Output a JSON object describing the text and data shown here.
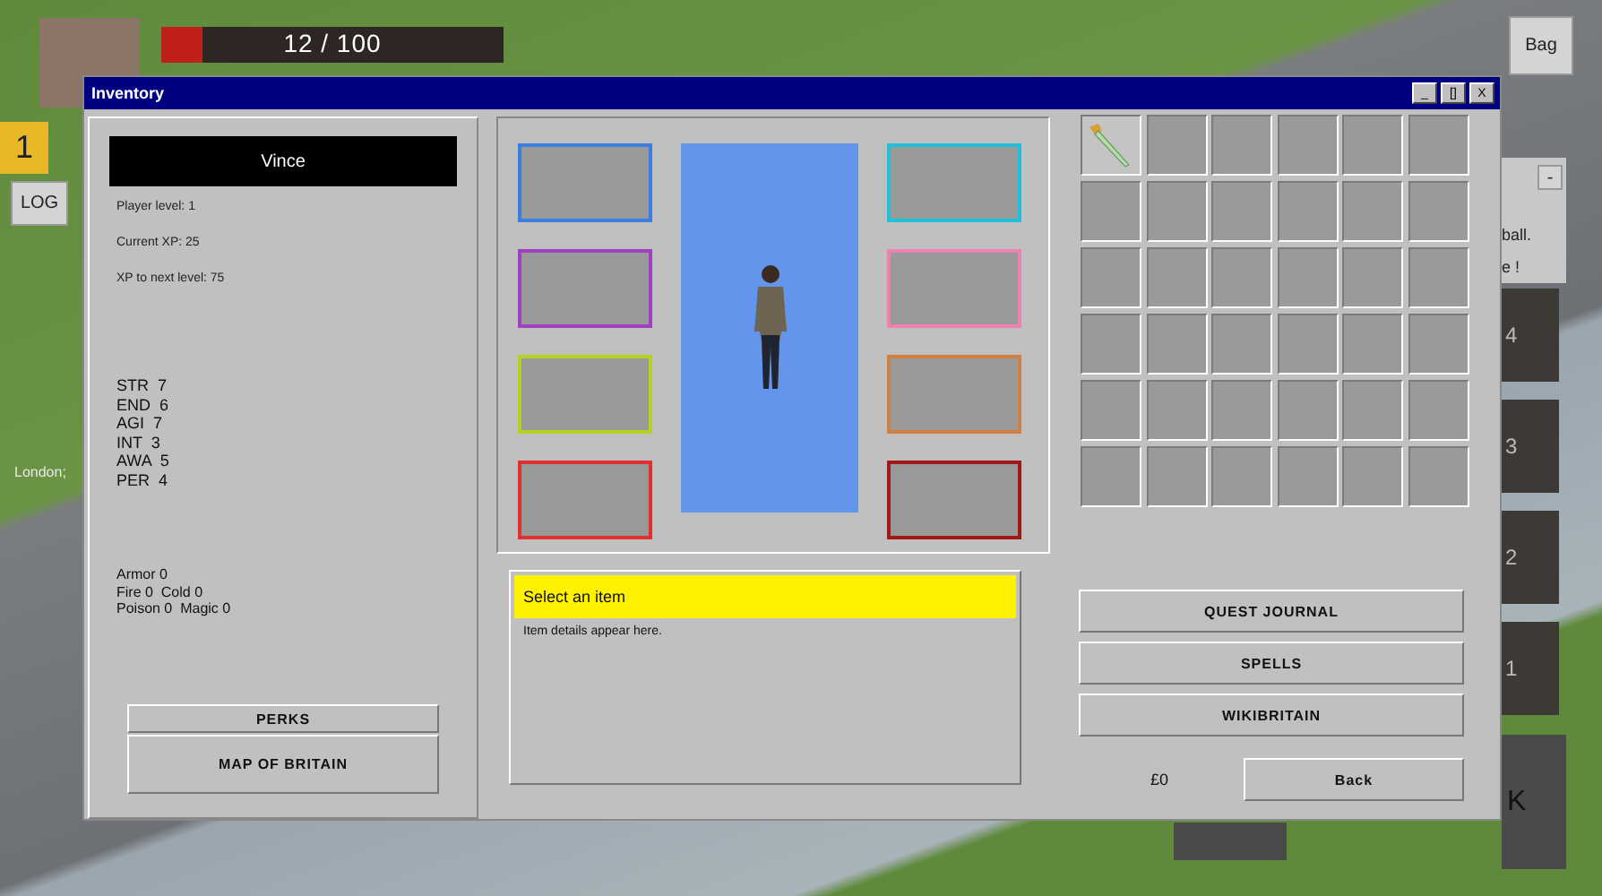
{
  "hud": {
    "health": {
      "reading": "12 / 100",
      "level": 0.12
    },
    "bag_button": "Bag",
    "level_badge": "1",
    "log_button": "LOG",
    "location": "London;",
    "side_panel": {
      "collapse_button": "-",
      "line_1": "ball.",
      "line_2": "e !"
    },
    "hotbar": [
      "4",
      "3",
      "2",
      "1"
    ],
    "key_tile": "K"
  },
  "window": {
    "title": "Inventory",
    "controls": [
      "_",
      "[]",
      "X"
    ]
  },
  "character": {
    "name": "Vince",
    "info": [
      "Player level: 1",
      "Current XP: 25",
      "XP to next level: 75"
    ],
    "attributes": [
      "STR  7",
      "END  6",
      "AGI  7",
      "INT  3",
      "AWA  5",
      "PER  4"
    ],
    "resistances": [
      "Armor 0",
      "Fire 0  Cold 0",
      "Poison 0  Magic 0"
    ],
    "buttons": [
      "PERKS",
      "MAP OF BRITAIN"
    ]
  },
  "equipment": {
    "left_slots": [
      {
        "color": "#3a7ee0"
      },
      {
        "color": "#a040c0"
      },
      {
        "color": "#b8d020"
      },
      {
        "color": "#e03030"
      }
    ],
    "right_slots": [
      {
        "color": "#20c0d8"
      },
      {
        "color": "#f080b0"
      },
      {
        "color": "#d08040"
      },
      {
        "color": "#a01818"
      }
    ]
  },
  "details": {
    "title": "Select an item",
    "text": "Item details appear here."
  },
  "inventory": {
    "cells": [
      {
        "filled": true
      },
      {
        "filled": false
      },
      {
        "filled": false
      },
      {
        "filled": false
      },
      {
        "filled": false
      },
      {
        "filled": false
      },
      {
        "filled": false
      },
      {
        "filled": false
      },
      {
        "filled": false
      },
      {
        "filled": false
      },
      {
        "filled": false
      },
      {
        "filled": false
      },
      {
        "filled": false
      },
      {
        "filled": false
      },
      {
        "filled": false
      },
      {
        "filled": false
      },
      {
        "filled": false
      },
      {
        "filled": false
      },
      {
        "filled": false
      },
      {
        "filled": false
      },
      {
        "filled": false
      },
      {
        "filled": false
      },
      {
        "filled": false
      },
      {
        "filled": false
      },
      {
        "filled": false
      },
      {
        "filled": false
      },
      {
        "filled": false
      },
      {
        "filled": false
      },
      {
        "filled": false
      },
      {
        "filled": false
      },
      {
        "filled": false
      },
      {
        "filled": false
      },
      {
        "filled": false
      },
      {
        "filled": false
      },
      {
        "filled": false
      },
      {
        "filled": false
      }
    ]
  },
  "menu_buttons": [
    "QUEST JOURNAL",
    "SPELLS",
    "WIKIBRITAIN"
  ],
  "money": "£0",
  "back_button": "Back"
}
